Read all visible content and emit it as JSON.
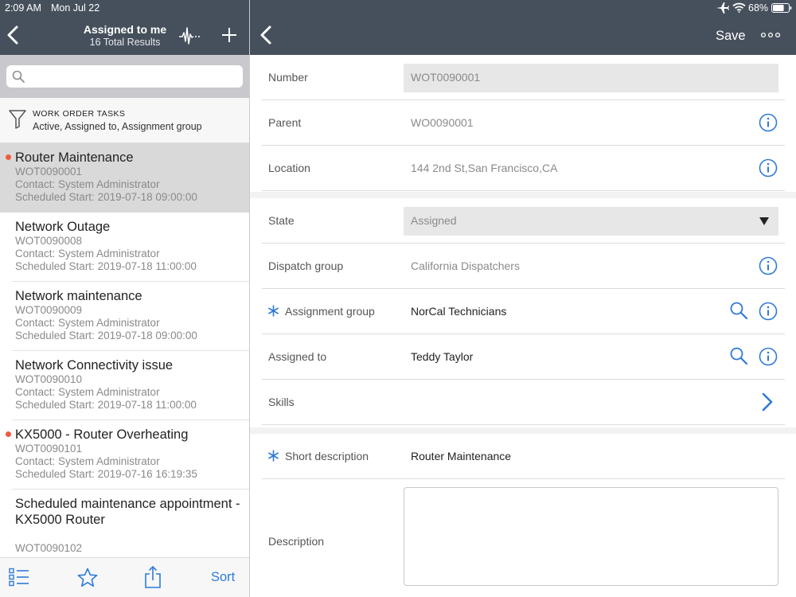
{
  "status_bar": {
    "time": "2:09 AM",
    "date": "Mon Jul 22",
    "battery": "68%"
  },
  "list_header": {
    "title": "Assigned to me",
    "subtitle": "16 Total Results"
  },
  "search": {
    "placeholder": "",
    "value": ""
  },
  "filter": {
    "title": "WORK ORDER TASKS",
    "values": "Active, Assigned to, Assignment group"
  },
  "tasks": [
    {
      "title": "Router Maintenance",
      "number": "WOT0090001",
      "contact": "Contact: System Administrator",
      "start": "Scheduled Start: 2019-07-18 09:00:00",
      "flag": true,
      "selected": true
    },
    {
      "title": "Network Outage",
      "number": "WOT0090008",
      "contact": "Contact: System Administrator",
      "start": "Scheduled Start: 2019-07-18 11:00:00",
      "flag": false,
      "selected": false
    },
    {
      "title": "Network maintenance",
      "number": "WOT0090009",
      "contact": "Contact: System Administrator",
      "start": "Scheduled Start: 2019-07-18 09:00:00",
      "flag": false,
      "selected": false
    },
    {
      "title": "Network Connectivity issue",
      "number": "WOT0090010",
      "contact": "Contact: System Administrator",
      "start": "Scheduled Start: 2019-07-18 11:00:00",
      "flag": false,
      "selected": false
    },
    {
      "title": "KX5000 - Router Overheating",
      "number": "WOT0090101",
      "contact": "Contact: System Administrator",
      "start": "Scheduled Start: 2019-07-16 16:19:35",
      "flag": true,
      "selected": false
    },
    {
      "title": "Scheduled maintenance appointment - KX5000 Router",
      "number": "WOT0090102",
      "contact": "",
      "start": "",
      "flag": false,
      "selected": false
    }
  ],
  "left_toolbar": {
    "sort_label": "Sort"
  },
  "detail_header": {
    "save_label": "Save"
  },
  "form": {
    "number": {
      "label": "Number",
      "value": "WOT0090001"
    },
    "parent": {
      "label": "Parent",
      "value": "WO0090001"
    },
    "location": {
      "label": "Location",
      "value": "144 2nd St,San Francisco,CA"
    },
    "state": {
      "label": "State",
      "value": "Assigned"
    },
    "dispatch_group": {
      "label": "Dispatch group",
      "value": "California Dispatchers"
    },
    "assignment_group": {
      "label": "Assignment group",
      "value": "NorCal Technicians"
    },
    "assigned_to": {
      "label": "Assigned to",
      "value": "Teddy Taylor"
    },
    "skills": {
      "label": "Skills"
    },
    "short_description": {
      "label": "Short description",
      "value": "Router Maintenance"
    },
    "description": {
      "label": "Description",
      "value": ""
    }
  },
  "colors": {
    "header_bg": "#46505c",
    "accent": "#2f7ad9",
    "flag_dot": "#ef5b3f",
    "selected_row": "#d9d9d9"
  },
  "icons": [
    "chevron-left-icon",
    "pulse-icon",
    "plus-icon",
    "search-icon",
    "filter-icon",
    "list-icon",
    "star-icon",
    "share-icon",
    "airplane-icon",
    "wifi-icon",
    "battery-icon",
    "more-icon",
    "info-icon",
    "lookup-icon",
    "chevron-right-icon",
    "required-asterisk-icon",
    "dropdown-arrow-icon"
  ]
}
